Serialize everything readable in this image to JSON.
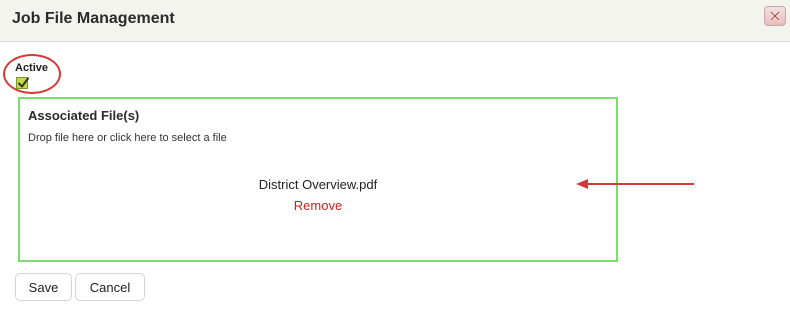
{
  "dialog": {
    "title": "Job File Management"
  },
  "active": {
    "label": "Active",
    "checked": true
  },
  "files": {
    "heading": "Associated File(s)",
    "hint": "Drop file here or click here to select a file",
    "file_name": "District Overview.pdf",
    "remove_label": "Remove"
  },
  "actions": {
    "save_label": "Save",
    "cancel_label": "Cancel"
  },
  "colors": {
    "dropzone_border": "#7ddc6e",
    "remove_link": "#d01f1f",
    "annotation": "#d23a3a"
  },
  "icons": {
    "close": "close-icon",
    "checkmark": "checkmark-icon",
    "annotation_arrow": "arrow-left-icon"
  }
}
